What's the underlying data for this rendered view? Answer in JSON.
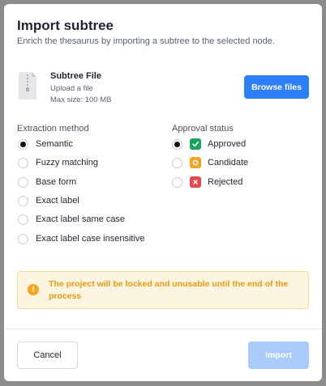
{
  "dialog": {
    "title": "Import subtree",
    "subtitle": "Enrich the thesaurus by importing a subtree to the selected node."
  },
  "file": {
    "name": "Subtree File",
    "hint1": "Upload a file",
    "hint2": "Max size: 100 MB",
    "browse_label": "Browse files",
    "icon": "zip-file-icon"
  },
  "extraction": {
    "label": "Extraction method",
    "selected": "Semantic",
    "options": [
      "Semantic",
      "Fuzzy matching",
      "Base form",
      "Exact label",
      "Exact label same case",
      "Exact label case insensitive"
    ]
  },
  "approval": {
    "label": "Approval status",
    "selected": "Approved",
    "options": [
      {
        "label": "Approved",
        "icon": "check-icon",
        "color": "#1aa35a"
      },
      {
        "label": "Candidate",
        "icon": "circle-icon",
        "color": "#f5a524"
      },
      {
        "label": "Rejected",
        "icon": "x-icon",
        "color": "#e5484d"
      }
    ]
  },
  "warning": {
    "text": "The project will be locked and unusable until the end of the process",
    "color": "#e89a12"
  },
  "footer": {
    "cancel_label": "Cancel",
    "import_label": "Import"
  },
  "colors": {
    "primary": "#2d7ff9",
    "primary_disabled": "#a8cbfb"
  }
}
